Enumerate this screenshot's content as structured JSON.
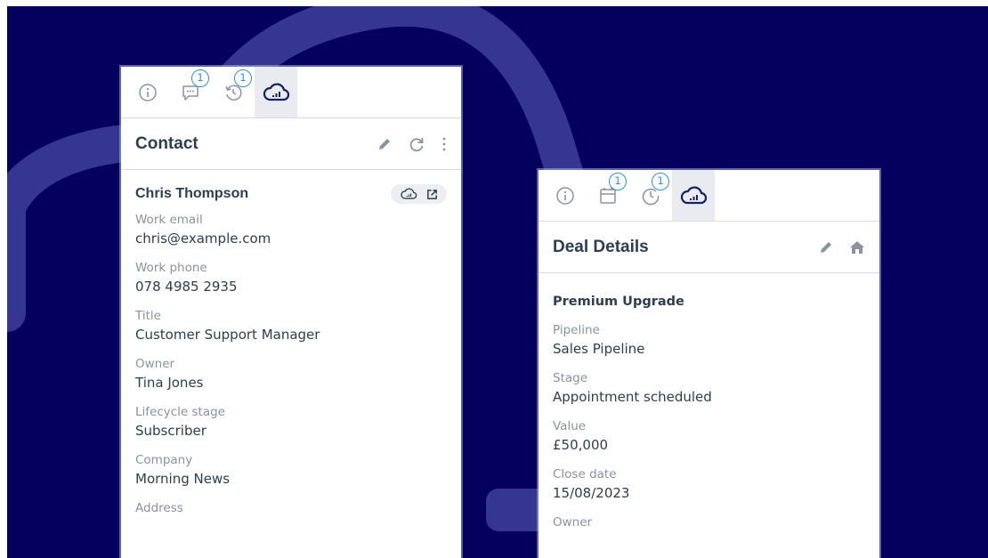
{
  "theme": {
    "background": "#05005e",
    "decor": "#3d3f9a",
    "accent": "#2f8fe0",
    "icon_dark": "#17215e",
    "icon_gray": "#8a939e"
  },
  "contact_panel": {
    "tabs": [
      {
        "icon": "info-icon",
        "badge": ""
      },
      {
        "icon": "comment-icon",
        "badge": "1"
      },
      {
        "icon": "history-icon",
        "badge": "1"
      },
      {
        "icon": "cloud-chart-icon",
        "badge": ""
      }
    ],
    "title": "Contact",
    "actions": [
      "pencil-icon",
      "refresh-icon",
      "more-vertical-icon"
    ],
    "record_name": "Chris Thompson",
    "record_actions": [
      "cloud-chart-icon",
      "external-link-icon"
    ],
    "fields": [
      {
        "label": "Work email",
        "value": "chris@example.com"
      },
      {
        "label": "Work phone",
        "value": "078 4985 2935"
      },
      {
        "label": "Title",
        "value": "Customer Support Manager"
      },
      {
        "label": "Owner",
        "value": "Tina Jones"
      },
      {
        "label": "Lifecycle stage",
        "value": "Subscriber"
      },
      {
        "label": "Company",
        "value": "Morning News"
      },
      {
        "label": "Address",
        "value": ""
      }
    ]
  },
  "deal_panel": {
    "tabs": [
      {
        "icon": "info-icon",
        "badge": ""
      },
      {
        "icon": "calendar-icon",
        "badge": "1"
      },
      {
        "icon": "clock-icon",
        "badge": "1"
      },
      {
        "icon": "cloud-chart-icon",
        "badge": ""
      }
    ],
    "title": "Deal Details",
    "actions": [
      "pencil-icon",
      "home-icon"
    ],
    "record_name": "Premium Upgrade",
    "fields": [
      {
        "label": "Pipeline",
        "value": "Sales Pipeline"
      },
      {
        "label": "Stage",
        "value": "Appointment scheduled"
      },
      {
        "label": "Value",
        "value": "£50,000"
      },
      {
        "label": "Close date",
        "value": "15/08/2023"
      },
      {
        "label": "Owner",
        "value": ""
      }
    ]
  }
}
